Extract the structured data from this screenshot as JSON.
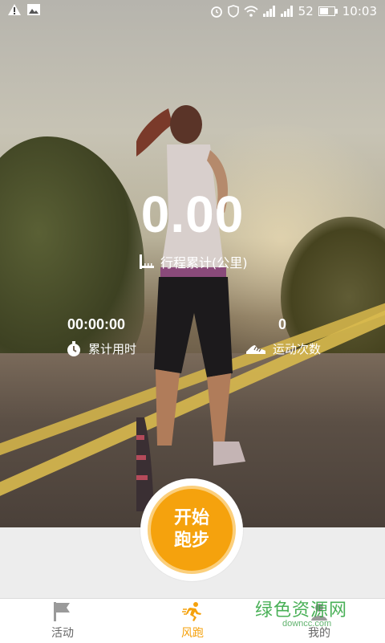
{
  "status_bar": {
    "battery": "52",
    "time": "10:03"
  },
  "stats": {
    "distance_value": "0.00",
    "distance_label": "行程累计(公里)",
    "time_value": "00:00:00",
    "time_label": "累计用时",
    "count_value": "0",
    "count_label": "运动次数"
  },
  "start_button": {
    "line1": "开始",
    "line2": "跑步"
  },
  "tabs": [
    {
      "label": "活动",
      "icon": "flag-icon",
      "active": false
    },
    {
      "label": "风跑",
      "icon": "runner-icon",
      "active": true
    },
    {
      "label": "我的",
      "icon": "person-icon",
      "active": false
    }
  ],
  "watermark": {
    "text": "绿色资源网",
    "sub": "downcc.com"
  },
  "colors": {
    "accent": "#f5a20d",
    "accent_light": "#fbcf7c",
    "tab_inactive": "#666666"
  }
}
